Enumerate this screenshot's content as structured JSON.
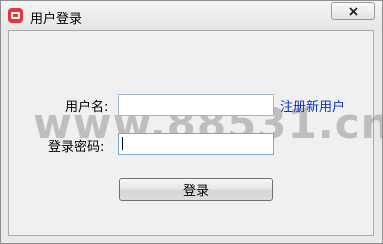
{
  "window": {
    "title": "用户登录"
  },
  "form": {
    "username_label": "用户名:",
    "username_value": "",
    "password_label": "登录密码:",
    "password_value": "",
    "register_link": "注册新用户",
    "login_button": "登录"
  },
  "watermark": "www.88531.cn",
  "icons": {
    "app": "app-logo-icon",
    "close": "close-icon"
  },
  "colors": {
    "link": "#0a31c7",
    "app_icon": "#e8323c"
  }
}
